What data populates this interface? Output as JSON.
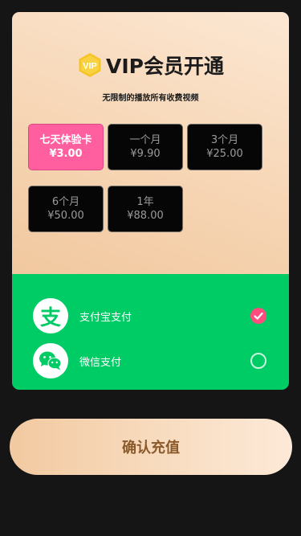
{
  "header": {
    "vip_badge": "VIP",
    "title": "VIP会员开通",
    "subtitle": "无限制的播放所有收费视频"
  },
  "plans": [
    {
      "name": "七天体验卡",
      "price": "¥3.00",
      "selected": true
    },
    {
      "name": "一个月",
      "price": "¥9.90",
      "selected": false
    },
    {
      "name": "3个月",
      "price": "¥25.00",
      "selected": false
    },
    {
      "name": "6个月",
      "price": "¥50.00",
      "selected": false
    },
    {
      "name": "1年",
      "price": "¥88.00",
      "selected": false
    }
  ],
  "payment": {
    "methods": [
      {
        "label": "支付宝支付",
        "icon": "alipay-icon",
        "icon_glyph": "支",
        "selected": true
      },
      {
        "label": "微信支付",
        "icon": "wechat-icon",
        "selected": false
      }
    ]
  },
  "confirm": {
    "label": "确认充值"
  },
  "colors": {
    "selected_plan": "#ff5f9e",
    "payment_bg": "#00cc66",
    "radio_checked": "#ff4d7d",
    "confirm_text": "#8a5a2b"
  }
}
